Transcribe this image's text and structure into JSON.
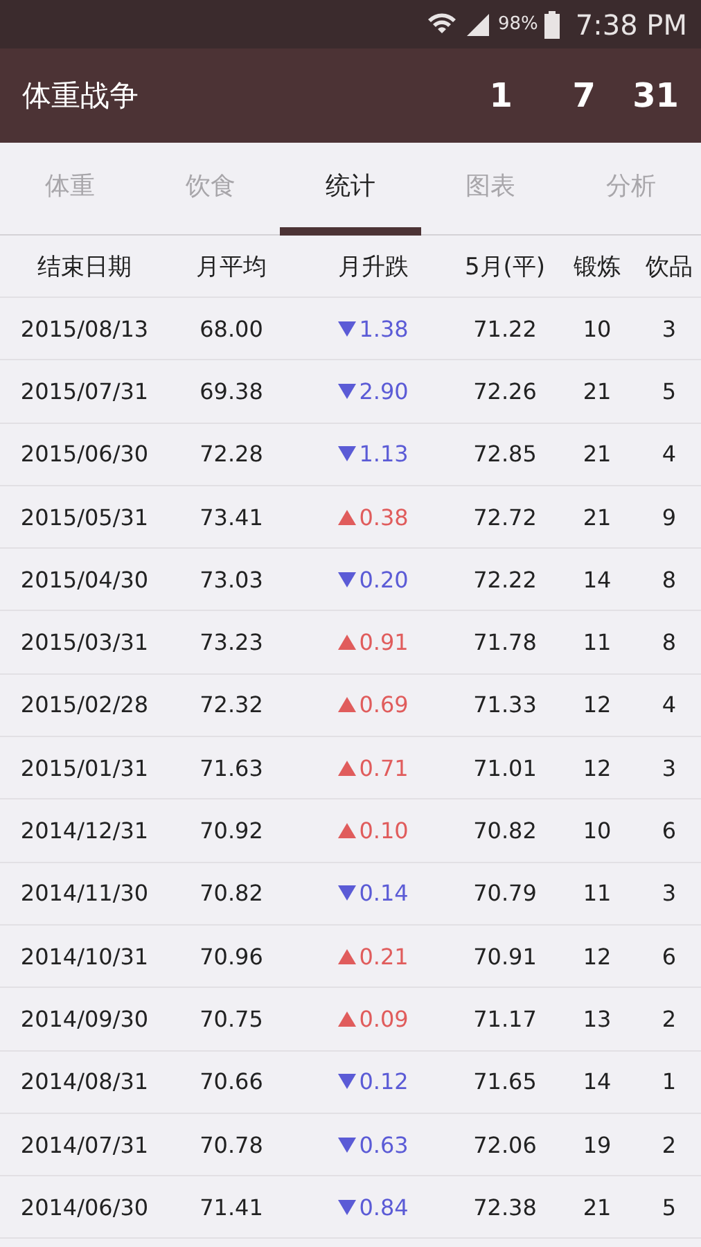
{
  "status_bar": {
    "battery": "98%",
    "time": "7:38 PM"
  },
  "header": {
    "title": "体重战争",
    "counters": [
      "1",
      "7",
      "31"
    ]
  },
  "tabs": [
    {
      "label": "体重",
      "selected": false
    },
    {
      "label": "饮食",
      "selected": false
    },
    {
      "label": "统计",
      "selected": true
    },
    {
      "label": "图表",
      "selected": false
    },
    {
      "label": "分析",
      "selected": false
    }
  ],
  "table": {
    "columns": [
      "结束日期",
      "月平均",
      "月升跌",
      "5月(平)",
      "锻炼",
      "饮品"
    ],
    "rows": [
      {
        "date": "2015/08/13",
        "avg": "68.00",
        "kind": "down",
        "change": "1.38",
        "may_avg": "71.22",
        "exercise": "10",
        "drinks": "3"
      },
      {
        "date": "2015/07/31",
        "avg": "69.38",
        "kind": "down",
        "change": "2.90",
        "may_avg": "72.26",
        "exercise": "21",
        "drinks": "5"
      },
      {
        "date": "2015/06/30",
        "avg": "72.28",
        "kind": "down",
        "change": "1.13",
        "may_avg": "72.85",
        "exercise": "21",
        "drinks": "4"
      },
      {
        "date": "2015/05/31",
        "avg": "73.41",
        "kind": "up",
        "change": "0.38",
        "may_avg": "72.72",
        "exercise": "21",
        "drinks": "9"
      },
      {
        "date": "2015/04/30",
        "avg": "73.03",
        "kind": "down",
        "change": "0.20",
        "may_avg": "72.22",
        "exercise": "14",
        "drinks": "8"
      },
      {
        "date": "2015/03/31",
        "avg": "73.23",
        "kind": "up",
        "change": "0.91",
        "may_avg": "71.78",
        "exercise": "11",
        "drinks": "8"
      },
      {
        "date": "2015/02/28",
        "avg": "72.32",
        "kind": "up",
        "change": "0.69",
        "may_avg": "71.33",
        "exercise": "12",
        "drinks": "4"
      },
      {
        "date": "2015/01/31",
        "avg": "71.63",
        "kind": "up",
        "change": "0.71",
        "may_avg": "71.01",
        "exercise": "12",
        "drinks": "3"
      },
      {
        "date": "2014/12/31",
        "avg": "70.92",
        "kind": "up",
        "change": "0.10",
        "may_avg": "70.82",
        "exercise": "10",
        "drinks": "6"
      },
      {
        "date": "2014/11/30",
        "avg": "70.82",
        "kind": "down",
        "change": "0.14",
        "may_avg": "70.79",
        "exercise": "11",
        "drinks": "3"
      },
      {
        "date": "2014/10/31",
        "avg": "70.96",
        "kind": "up",
        "change": "0.21",
        "may_avg": "70.91",
        "exercise": "12",
        "drinks": "6"
      },
      {
        "date": "2014/09/30",
        "avg": "70.75",
        "kind": "up",
        "change": "0.09",
        "may_avg": "71.17",
        "exercise": "13",
        "drinks": "2"
      },
      {
        "date": "2014/08/31",
        "avg": "70.66",
        "kind": "down",
        "change": "0.12",
        "may_avg": "71.65",
        "exercise": "14",
        "drinks": "1"
      },
      {
        "date": "2014/07/31",
        "avg": "70.78",
        "kind": "down",
        "change": "0.63",
        "may_avg": "72.06",
        "exercise": "19",
        "drinks": "2"
      },
      {
        "date": "2014/06/30",
        "avg": "71.41",
        "kind": "down",
        "change": "0.84",
        "may_avg": "72.38",
        "exercise": "21",
        "drinks": "5"
      }
    ]
  }
}
